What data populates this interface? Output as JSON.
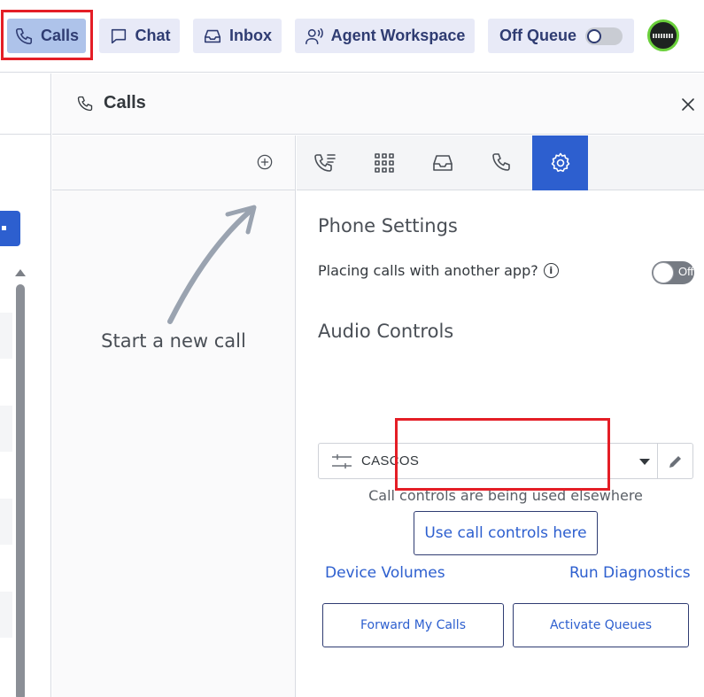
{
  "nav": {
    "calls": "Calls",
    "chat": "Chat",
    "inbox": "Inbox",
    "agent_workspace": "Agent Workspace",
    "queue_status": "Off Queue",
    "active_tab": "calls"
  },
  "panel": {
    "title": "Calls",
    "start_new_call": "Start a new call",
    "tabs": [
      "call-log-icon",
      "dialpad-icon",
      "voicemail-inbox-icon",
      "phone-icon",
      "settings-gear-icon"
    ],
    "active_tab": "settings"
  },
  "settings": {
    "phone_settings_heading": "Phone Settings",
    "placing_calls_label": "Placing calls with another app?",
    "placing_calls_toggle": "Off",
    "audio_controls_heading": "Audio Controls",
    "device_selected": "CASCOS",
    "call_controls_notice": "Call controls are being used elsewhere",
    "use_call_controls_button": "Use call controls here",
    "device_volumes_link": "Device Volumes",
    "run_diagnostics_link": "Run Diagnostics",
    "forward_calls_button": "Forward My Calls",
    "activate_queues_button": "Activate Queues"
  },
  "colors": {
    "accent": "#2d5fcf",
    "nav_text": "#2f3c72",
    "nav_bg": "#e8eaf7",
    "nav_active_bg": "#aec3ea",
    "highlight_red": "#e41e26"
  }
}
